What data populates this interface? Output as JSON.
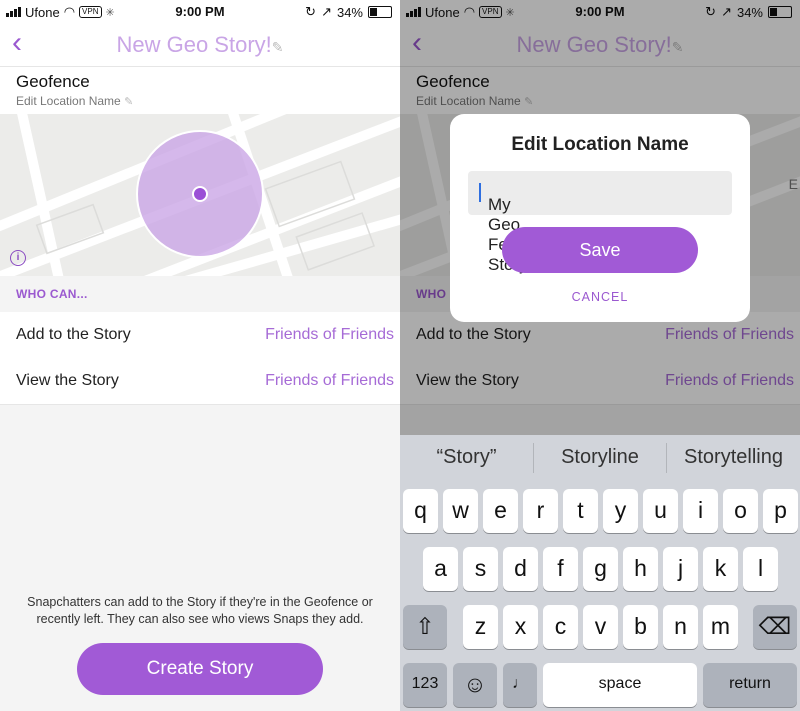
{
  "status_bar": {
    "carrier": "Ufone",
    "vpn": "VPN",
    "time": "9:00 PM",
    "battery": "34%",
    "battery_level": 0.34
  },
  "left": {
    "nav_title": "New Geo Story!",
    "geofence_title": "Geofence",
    "edit_location_label": "Edit Location Name",
    "who_can_header": "WHO CAN...",
    "rows": [
      {
        "label": "Add to the Story",
        "value": "Friends of Friends"
      },
      {
        "label": "View the Story",
        "value": "Friends of Friends"
      }
    ],
    "footnote": "Snapchatters can add to the Story if they're in the Geofence or recently left. They can also see who views Snaps they add.",
    "create_button": "Create Story"
  },
  "right": {
    "nav_title": "New Geo Story!",
    "geofence_title": "Geofence",
    "edit_location_label": "Edit Location Name",
    "who_can_header": "WHO",
    "rows": [
      {
        "label": "Add to the Story",
        "value": "Friends of Friends"
      },
      {
        "label": "View the Story",
        "value": "Friends of Friends"
      }
    ],
    "map_partial_letter": "E",
    "dialog": {
      "title": "Edit Location Name",
      "input_value": "My Geo Fenced Story",
      "save_label": "Save",
      "cancel_label": "CANCEL"
    },
    "keyboard": {
      "suggestions": [
        "“Story”",
        "Storyline",
        "Storytelling"
      ],
      "row1": [
        "q",
        "w",
        "e",
        "r",
        "t",
        "y",
        "u",
        "i",
        "o",
        "p"
      ],
      "row2": [
        "a",
        "s",
        "d",
        "f",
        "g",
        "h",
        "j",
        "k",
        "l"
      ],
      "row3": [
        "z",
        "x",
        "c",
        "v",
        "b",
        "n",
        "m"
      ],
      "numbers_key": "123",
      "space_key": "space",
      "return_key": "return"
    }
  },
  "colors": {
    "accent": "#a15ad6",
    "accent_light": "#c9a5e6"
  }
}
